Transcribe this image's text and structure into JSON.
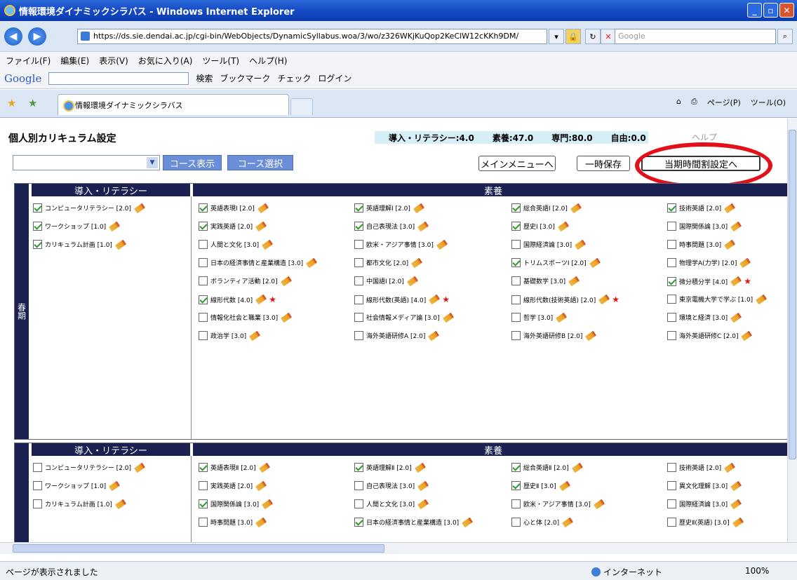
{
  "window": {
    "title": "情報環境ダイナミックシラバス - Windows Internet Explorer"
  },
  "address": {
    "url": "https://ds.sie.dendai.ac.jp/cgi-bin/WebObjects/DynamicSyllabus.woa/3/wo/z326WKjKuQop2KeClW12cKKh9DM/",
    "search_placeholder": "Google"
  },
  "menu": [
    "ファイル(F)",
    "編集(E)",
    "表示(V)",
    "お気に入り(A)",
    "ツール(T)",
    "ヘルプ(H)"
  ],
  "gbar": {
    "logo": "Google",
    "search": "検索",
    "bookmarks": "ブックマーク",
    "check": "チェック",
    "login": "ログイン"
  },
  "tab": {
    "label": "情報環境ダイナミックシラバス",
    "page": "ページ(P)",
    "tools": "ツール(O)"
  },
  "page": {
    "title": "個人別カリキュラム設定",
    "help": "ヘルプ"
  },
  "credits": {
    "intro": "導入・リテラシー:4.0",
    "liberal": "素養:47.0",
    "major": "専門:80.0",
    "free": "自由:0.0"
  },
  "buttons": {
    "course_view": "コース表示",
    "course_select": "コース選択",
    "main_menu": "メインメニューへ",
    "temp_save": "一時保存",
    "timetable": "当期時間割設定へ"
  },
  "sem1": {
    "label": "春期",
    "intro_header": "導入・リテラシー",
    "liberal_header": "素養",
    "intro": [
      {
        "t": "コンピュータリテラシー [2.0]",
        "c": true
      },
      {
        "t": "ワークショップ [1.0]",
        "c": true
      },
      {
        "t": "カリキュラム計画 [1.0]",
        "c": true
      }
    ],
    "cols": [
      [
        {
          "t": "英語表現Ⅰ [2.0]",
          "c": true
        },
        {
          "t": "実践英語 [2.0]",
          "c": true
        },
        {
          "t": "人間と文化 [3.0]",
          "c": false
        },
        {
          "t": "日本の経済事情と産業構造 [3.0]",
          "c": false
        },
        {
          "t": "ボランティア活動 [2.0]",
          "c": false
        },
        {
          "t": "線形代数 [4.0]",
          "c": true,
          "s": true
        },
        {
          "t": "情報化社会と職業 [3.0]",
          "c": false
        },
        {
          "t": "政治学 [3.0]",
          "c": false
        }
      ],
      [
        {
          "t": "英語理解Ⅰ [2.0]",
          "c": true
        },
        {
          "t": "自己表現法 [3.0]",
          "c": true
        },
        {
          "t": "欧米・アジア事情 [3.0]",
          "c": false
        },
        {
          "t": "都市文化 [2.0]",
          "c": false
        },
        {
          "t": "中国語Ⅰ [2.0]",
          "c": false
        },
        {
          "t": "線形代数(英語) [4.0]",
          "c": false,
          "s": true
        },
        {
          "t": "社会情報メディア論 [3.0]",
          "c": false
        },
        {
          "t": "海外英語研修A [2.0]",
          "c": false
        }
      ],
      [
        {
          "t": "総合英語Ⅰ [2.0]",
          "c": true
        },
        {
          "t": "歴史Ⅰ [3.0]",
          "c": true
        },
        {
          "t": "国際経済論 [3.0]",
          "c": false
        },
        {
          "t": "トリムスポーツⅠ [2.0]",
          "c": true
        },
        {
          "t": "基礎数学 [3.0]",
          "c": false
        },
        {
          "t": "線形代数(技術英語) [2.0]",
          "c": false,
          "s": true
        },
        {
          "t": "哲学 [3.0]",
          "c": false
        },
        {
          "t": "海外英語研修B [2.0]",
          "c": false
        }
      ],
      [
        {
          "t": "技術英語 [2.0]",
          "c": true
        },
        {
          "t": "国際関係論 [3.0]",
          "c": false
        },
        {
          "t": "時事問題 [3.0]",
          "c": false
        },
        {
          "t": "物理学A(力学) [2.0]",
          "c": false
        },
        {
          "t": "微分積分学 [4.0]",
          "c": true,
          "s": true
        },
        {
          "t": "東京電機大学で学ぶ [1.0]",
          "c": false
        },
        {
          "t": "環境と経済 [3.0]",
          "c": false
        },
        {
          "t": "海外英語研修C [2.0]",
          "c": false
        }
      ]
    ]
  },
  "sem2": {
    "intro_header": "導入・リテラシー",
    "liberal_header": "素養",
    "intro": [
      {
        "t": "コンピュータリテラシー [2.0]",
        "c": false
      },
      {
        "t": "ワークショップ [1.0]",
        "c": false
      },
      {
        "t": "カリキュラム計画 [1.0]",
        "c": false
      }
    ],
    "cols": [
      [
        {
          "t": "英語表現Ⅱ [2.0]",
          "c": true
        },
        {
          "t": "実践英語 [2.0]",
          "c": false
        },
        {
          "t": "国際関係論 [3.0]",
          "c": true
        },
        {
          "t": "時事問題 [3.0]",
          "c": false
        }
      ],
      [
        {
          "t": "英語理解Ⅱ [2.0]",
          "c": true
        },
        {
          "t": "自己表現法 [3.0]",
          "c": false
        },
        {
          "t": "人間と文化 [3.0]",
          "c": false
        },
        {
          "t": "日本の経済事情と産業構造 [3.0]",
          "c": true
        }
      ],
      [
        {
          "t": "総合英語Ⅱ [2.0]",
          "c": true
        },
        {
          "t": "歴史Ⅱ [3.0]",
          "c": true
        },
        {
          "t": "欧米・アジア事情 [3.0]",
          "c": false
        },
        {
          "t": "心と体 [2.0]",
          "c": false
        }
      ],
      [
        {
          "t": "技術英語 [2.0]",
          "c": false
        },
        {
          "t": "異文化理解 [3.0]",
          "c": false
        },
        {
          "t": "国際経済論 [3.0]",
          "c": false
        },
        {
          "t": "歴史Ⅱ(英語) [3.0]",
          "c": false
        }
      ]
    ]
  },
  "status": {
    "text": "ページが表示されました",
    "zone": "インターネット",
    "zoom": "100%"
  }
}
